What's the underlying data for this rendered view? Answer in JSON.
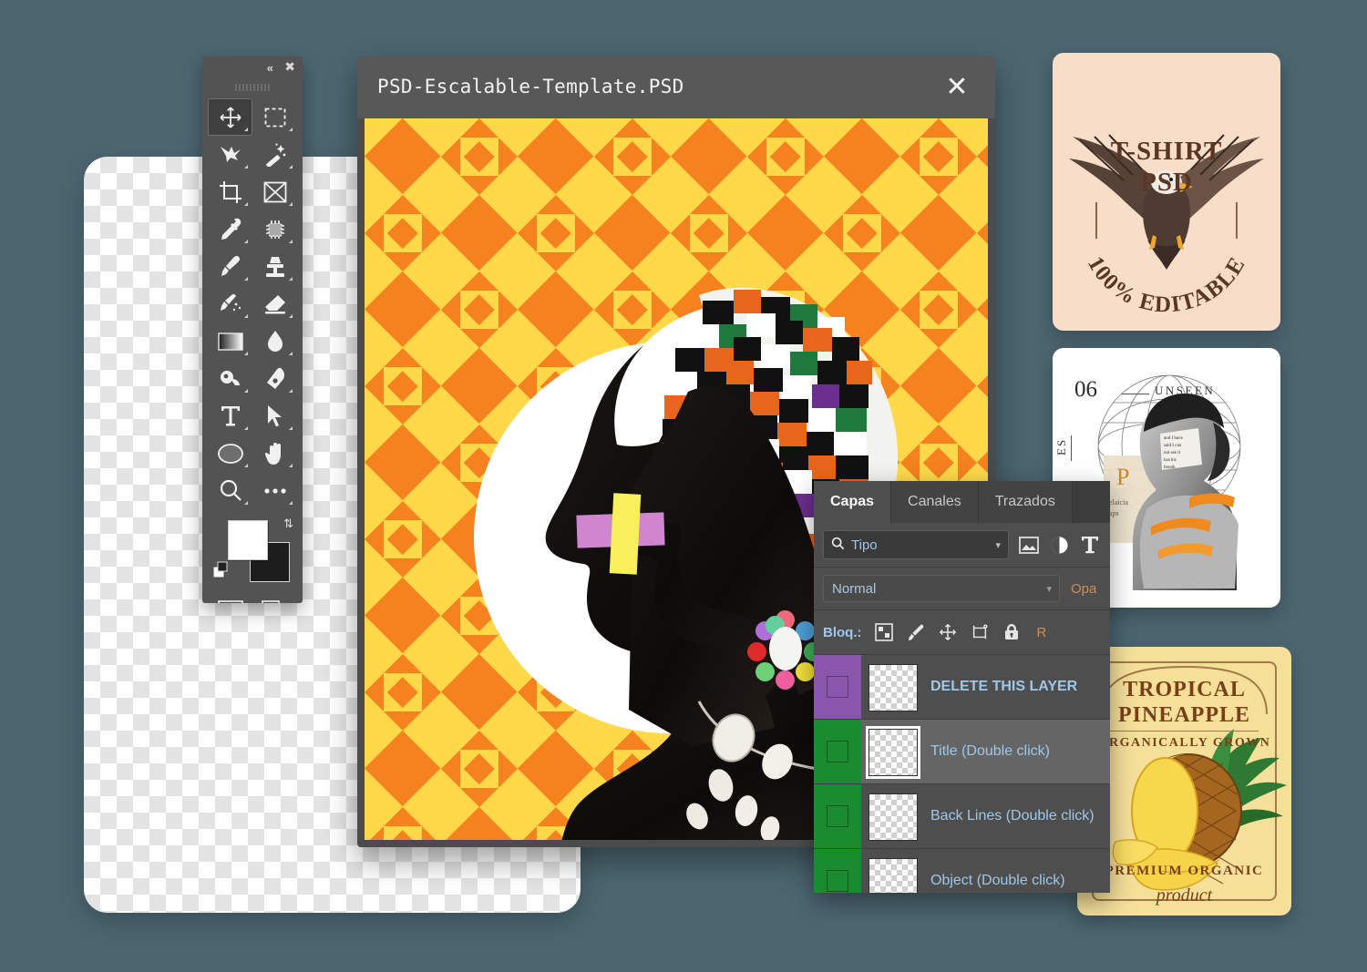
{
  "page": {
    "background_color": "#4c6670"
  },
  "tool_palette": {
    "header": {
      "collapse_icon": "double-chevron-left-icon",
      "close_icon": "close-icon"
    },
    "tools": [
      {
        "name": "move-tool",
        "icon": "move-arrows-icon",
        "active": true
      },
      {
        "name": "marquee-tool",
        "icon": "rectangular-marquee-icon",
        "active": false
      },
      {
        "name": "lasso-tool",
        "icon": "lasso-icon",
        "active": false
      },
      {
        "name": "magic-wand-tool",
        "icon": "magic-wand-icon",
        "active": false
      },
      {
        "name": "crop-tool",
        "icon": "crop-icon",
        "active": false
      },
      {
        "name": "frame-tool",
        "icon": "frame-icon",
        "active": false
      },
      {
        "name": "eyedropper-tool",
        "icon": "eyedropper-icon",
        "active": false
      },
      {
        "name": "healing-brush-tool",
        "icon": "spot-healing-icon",
        "active": false
      },
      {
        "name": "brush-tool",
        "icon": "brush-icon",
        "active": false
      },
      {
        "name": "clone-stamp-tool",
        "icon": "stamp-icon",
        "active": false
      },
      {
        "name": "history-brush-tool",
        "icon": "history-brush-icon",
        "active": false
      },
      {
        "name": "eraser-tool",
        "icon": "eraser-icon",
        "active": false
      },
      {
        "name": "gradient-tool",
        "icon": "gradient-icon",
        "active": false
      },
      {
        "name": "blur-tool",
        "icon": "water-drop-icon",
        "active": false
      },
      {
        "name": "dodge-tool",
        "icon": "dodge-icon",
        "active": false
      },
      {
        "name": "pen-tool",
        "icon": "pen-icon",
        "active": false
      },
      {
        "name": "type-tool",
        "icon": "text-T-icon",
        "active": false
      },
      {
        "name": "path-selection-tool",
        "icon": "arrow-cursor-icon",
        "active": false
      },
      {
        "name": "shape-tool",
        "icon": "ellipse-icon",
        "active": false
      },
      {
        "name": "hand-tool",
        "icon": "hand-icon",
        "active": false
      },
      {
        "name": "zoom-tool",
        "icon": "magnifier-icon",
        "active": false
      },
      {
        "name": "edit-toolbar-tool",
        "icon": "ellipsis-icon",
        "active": false
      }
    ],
    "color_swatches": {
      "foreground_color": "#ffffff",
      "background_color": "#1d1d1d",
      "swap_icon": "swap-arrows-icon",
      "default_icon": "default-colors-icon"
    },
    "bottom_tools": [
      {
        "name": "quick-mask-button",
        "icon": "quick-mask-icon"
      },
      {
        "name": "screen-mode-button",
        "icon": "screen-mode-icon"
      }
    ]
  },
  "document_window": {
    "title": "PSD-Escalable-Template.PSD",
    "close_icon": "close-icon",
    "canvas": {
      "pattern_colors": {
        "orange": "#f5821f",
        "yellow": "#ffd94a"
      },
      "circle_color": "#ffffff",
      "tape_purple": "#cf86cf",
      "tape_yellow": "#f7ef5b"
    }
  },
  "layers_panel": {
    "tabs": [
      {
        "label": "Capas",
        "active": true
      },
      {
        "label": "Canales",
        "active": false
      },
      {
        "label": "Trazados",
        "active": false
      }
    ],
    "filter": {
      "search_icon": "search-icon",
      "value": "Tipo",
      "caret_icon": "chevron-down-icon",
      "icons": [
        "image-filter-icon",
        "adjustment-filter-icon",
        "type-filter-icon"
      ]
    },
    "blend": {
      "mode": "Normal",
      "caret_icon": "chevron-down-icon",
      "opacity_label": "Opa"
    },
    "lock": {
      "label": "Bloq.:",
      "icons": [
        "transparency-lock-icon",
        "brush-lock-icon",
        "move-lock-icon",
        "artboard-lock-icon",
        "lock-all-icon"
      ],
      "fill_label": "R"
    },
    "layers": [
      {
        "name": "DELETE THIS LAYER",
        "color": "#8a56ac",
        "selected": false
      },
      {
        "name": "Title (Double click)",
        "color": "#1a8b2f",
        "selected": true
      },
      {
        "name": "Back Lines (Double click)",
        "color": "#1a8b2f",
        "selected": false
      },
      {
        "name": "Object (Double click)",
        "color": "#1a8b2f",
        "selected": false
      }
    ]
  },
  "side_cards": {
    "tshirt": {
      "line1": "T-SHIRT",
      "line2": "PSD",
      "arc_text": "100% EDITABLE",
      "background_color": "#f8ddc8",
      "ink_color": "#5a3724",
      "art": "eagle-illustration"
    },
    "unseen": {
      "number": "06",
      "label": "UNSEEN",
      "side_label": "ES",
      "background_color": "#ffffff",
      "art": "woman-collage-photo"
    },
    "pineapple": {
      "line1": "TROPICAL",
      "line2": "PINEAPPLE",
      "line3": "ORGANICALLY GROWN",
      "line4": "PREMIUM ORGANIC",
      "line5": "product",
      "background_color": "#f5e09a",
      "ink_color": "#7b3f18",
      "art": "pineapple-illustration"
    }
  }
}
